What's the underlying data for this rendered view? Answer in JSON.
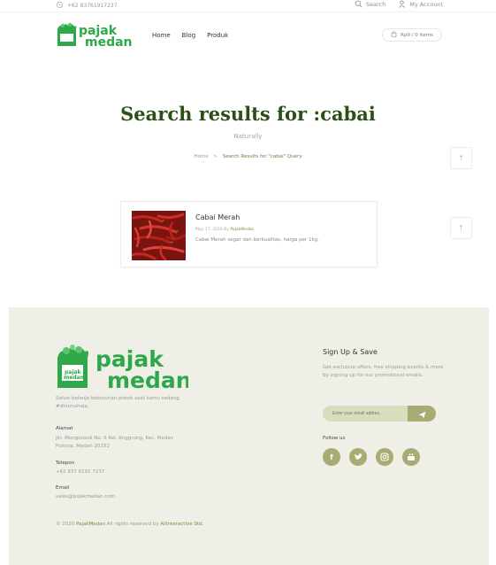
{
  "topbar": {
    "phone": "+62 83761917237",
    "search_label": "Search",
    "account_label": "My Account"
  },
  "brand": {
    "name_line1": "pajak",
    "name_line2": "medan",
    "color": "#2ea84a"
  },
  "nav": {
    "items": [
      "Home",
      "Blog",
      "Produk"
    ]
  },
  "cart": {
    "label": "Rp0 / 0 items"
  },
  "hero": {
    "title": "Search results for :cabai",
    "subtitle": "Naturally"
  },
  "breadcrumb": {
    "home": "Home",
    "separator": ">",
    "current": "Search Results for \"cabai\" Query"
  },
  "results": [
    {
      "title": "Cabai Merah",
      "date_by": "May 17, 2020 By",
      "author": "PajakMedan",
      "excerpt": "Cabai Merah segar dan berkualitas, harga per 1kg."
    }
  ],
  "scroll_up_icon": "arrow-up",
  "footer": {
    "tagline": "Solusi belanja kebutuhan pokok saat kamu sedang #dirumahaja.",
    "address_label": "Alamat",
    "address_value": "Jln. Mongonsidi No. 6 Kel. Anggrung, Kec. Medan Polonia, Medan 20152",
    "phone_label": "Telepon",
    "phone_value": "+62 837 6191 7237",
    "email_label": "Email",
    "email_value": "sales@pajakmedan.com",
    "copyright_prefix": "© 2020",
    "copyright_brand": "PajakMedan",
    "copyright_mid": "All rights reserved by",
    "copyright_company": "Allinteractive Std.",
    "signup_title": "Sign Up & Save",
    "signup_text": "Get exclusive offers, free shipping events & more by signing up for our promotional emails.",
    "email_placeholder": "Enter your email addres...",
    "follow_label": "Follow us",
    "social_icons": [
      "facebook-icon",
      "twitter-icon",
      "instagram-icon",
      "youtube-icon"
    ],
    "accent_color": "#a6ac72",
    "background_color": "#efefe8"
  }
}
